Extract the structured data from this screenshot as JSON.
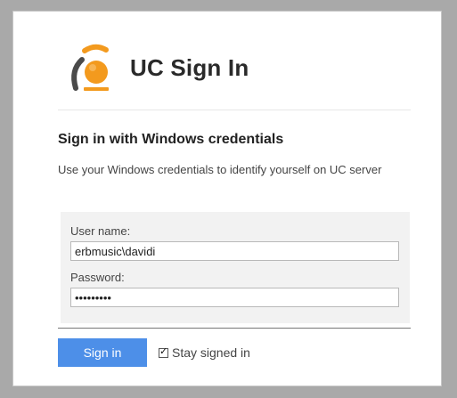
{
  "header": {
    "title": "UC Sign In",
    "logo_icon": "uc-logo-icon"
  },
  "section": {
    "title": "Sign in with Windows credentials",
    "description": "Use your Windows credentials to identify yourself on UC server"
  },
  "form": {
    "username_label": "User name:",
    "username_value": "erbmusic\\davidi",
    "password_label": "Password:",
    "password_value": "123456789"
  },
  "actions": {
    "sign_in_label": "Sign in",
    "stay_signed_in_label": "Stay signed in",
    "stay_signed_in_checked": true
  },
  "colors": {
    "accent": "#4d8fe8",
    "logo_orange": "#f39a1e",
    "logo_grey": "#4a4a4a"
  }
}
